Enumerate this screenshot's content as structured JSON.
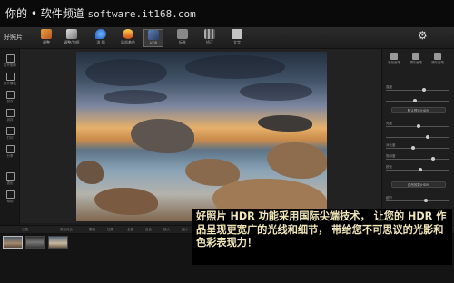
{
  "site": {
    "title": "你的 • 软件频道",
    "url": "software.it168.com"
  },
  "app": {
    "logo": "好照片"
  },
  "toolbar": {
    "tools": [
      {
        "label": "调整",
        "icon": "pencil-icon"
      },
      {
        "label": "调整/加框",
        "icon": "brush-icon"
      },
      {
        "label": "消 隔",
        "icon": "droplet-icon"
      },
      {
        "label": "局部着色",
        "icon": "flame-icon"
      },
      {
        "label": "HDR",
        "icon": "hdr-icon"
      },
      {
        "label": "标准",
        "icon": "square-icon"
      },
      {
        "label": "矫正",
        "icon": "grid-icon"
      },
      {
        "label": "文字",
        "icon": "text-icon"
      }
    ],
    "settings_icon": "gear-icon"
  },
  "sidebar": {
    "items": [
      {
        "label": "打开图像"
      },
      {
        "label": "打开模板"
      },
      {
        "label": "保存"
      },
      {
        "label": "另存"
      },
      {
        "label": "打印"
      },
      {
        "label": "分享"
      },
      {
        "label": "退出"
      },
      {
        "label": "帮助"
      }
    ]
  },
  "right_panel": {
    "tools": [
      {
        "label": "添加画笔"
      },
      {
        "label": "擦除画笔"
      },
      {
        "label": "清除画笔"
      }
    ],
    "sliders": [
      "强度",
      "",
      "亮度",
      "",
      "对比度",
      "饱和度",
      "锐化",
      "细节"
    ],
    "presets": [
      "默认预设(HDR)",
      "自然效果(HDR)"
    ]
  },
  "bottom_bar": {
    "items": [
      "已选",
      "前后对比",
      "撤销",
      "还原",
      "全部",
      "适合",
      "放大",
      "缩小",
      "1:1"
    ]
  },
  "caption": {
    "text": "好照片 HDR 功能采用国际尖端技术， 让您的 HDR 作品呈现更宽广的光线和细节， 带给您不可思议的光影和色彩表现力！"
  },
  "colors": {
    "caption": "#f0e6b8",
    "caption_bg": "#000000",
    "app_bg": "#1c1c1c"
  }
}
